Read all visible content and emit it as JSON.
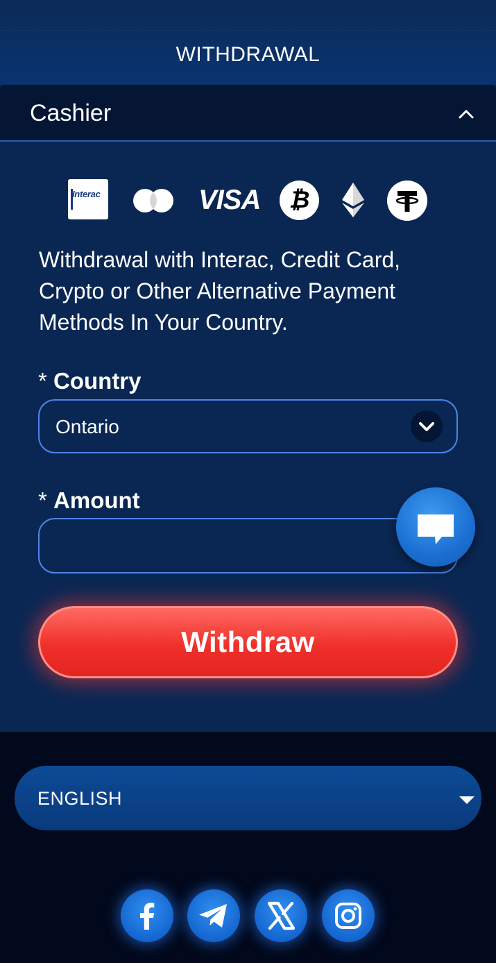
{
  "header": {
    "title": "WITHDRAWAL"
  },
  "cashier": {
    "title": "Cashier",
    "payment_icons": [
      "interac-icon",
      "mastercard-icon",
      "visa-icon",
      "bitcoin-icon",
      "ethereum-icon",
      "tether-icon"
    ],
    "interac_text": "Interac",
    "visa_text": "VISA",
    "bitcoin_symbol": "₿",
    "description": "Withdrawal with Interac, Credit Card, Crypto or Other Alternative Payment Methods In Your Country.",
    "country": {
      "required_mark": "*",
      "label": "Country",
      "value": "Ontario"
    },
    "amount": {
      "required_mark": "*",
      "label": "Amount",
      "value": ""
    },
    "withdraw_button": "Withdraw"
  },
  "footer": {
    "language": "ENGLISH",
    "social_icons": [
      "facebook-icon",
      "telegram-icon",
      "x-icon",
      "instagram-icon"
    ]
  },
  "colors": {
    "accent_red": "#f0302b",
    "accent_blue": "#1566d0",
    "field_border": "#4e84e6",
    "panel_bg": "#0a2753"
  }
}
